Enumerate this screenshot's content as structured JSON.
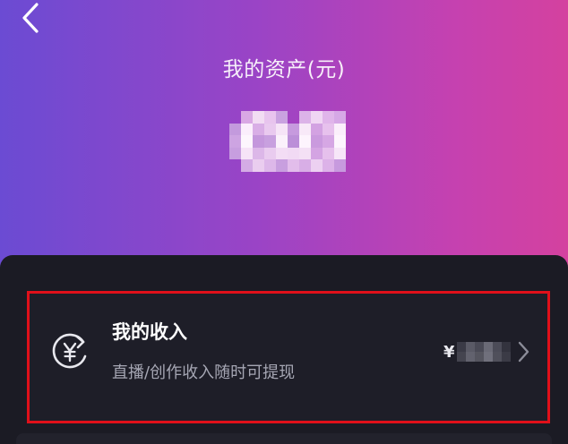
{
  "header": {
    "assets_title": "我的资产(元)",
    "assets_value": "0.00",
    "gradient_colors": [
      "#6b4bd3",
      "#c541b0",
      "#d4419f"
    ]
  },
  "nav": {
    "back_icon": "chevron-left-icon"
  },
  "income": {
    "title": "我的收入",
    "subtitle": "直播/创作收入随时可提现",
    "currency_symbol": "¥",
    "icon": "yen-refresh-icon",
    "chevron_icon": "chevron-right-icon",
    "highlight_color": "#e0101a"
  }
}
